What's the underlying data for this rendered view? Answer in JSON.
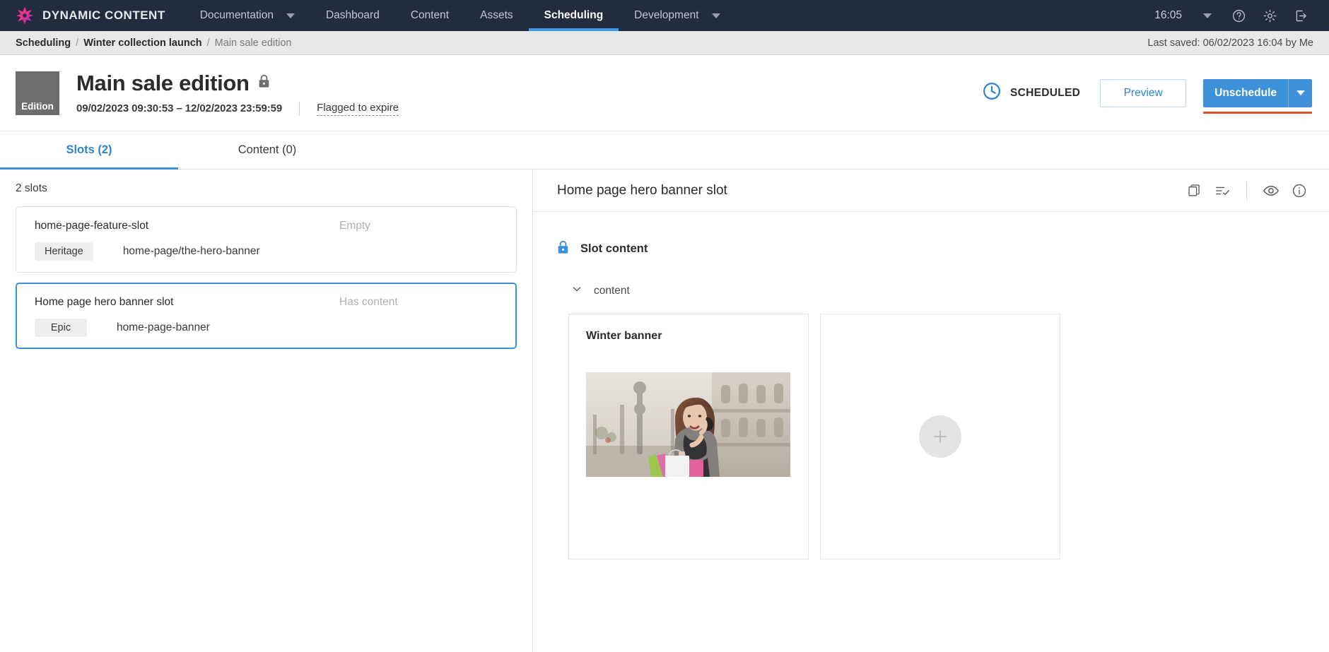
{
  "topnav": {
    "brand": "DYNAMIC CONTENT",
    "items": [
      {
        "label": "Documentation",
        "has_caret": true,
        "active": false
      },
      {
        "label": "Dashboard",
        "has_caret": false,
        "active": false
      },
      {
        "label": "Content",
        "has_caret": false,
        "active": false
      },
      {
        "label": "Assets",
        "has_caret": false,
        "active": false
      },
      {
        "label": "Scheduling",
        "has_caret": false,
        "active": true
      },
      {
        "label": "Development",
        "has_caret": true,
        "active": false
      }
    ],
    "time": "16:05",
    "icons": [
      "help-icon",
      "gear-icon",
      "logout-icon"
    ],
    "background": "#232c3d",
    "active_underline": "#3d9ae2"
  },
  "breadcrumb": {
    "items": [
      "Scheduling",
      "Winter collection launch",
      "Main sale edition"
    ],
    "separator": "/",
    "last_saved": "Last saved: 06/02/2023 16:04 by Me"
  },
  "header": {
    "badge": "Edition",
    "title": "Main sale edition",
    "locked": true,
    "date_range": "09/02/2023 09:30:53  –  12/02/2023 23:59:59",
    "flagged": "Flagged to expire",
    "status": "SCHEDULED",
    "status_icon": "clock-icon",
    "preview_label": "Preview",
    "unschedule_label": "Unschedule",
    "accent_blue": "#3d91d6",
    "underline_red": "#d9542b"
  },
  "tabs": [
    {
      "label": "Slots (2)",
      "active": true
    },
    {
      "label": "Content (0)",
      "active": false
    }
  ],
  "left_pane": {
    "count_label": "2 slots",
    "slots": [
      {
        "name": "home-page-feature-slot",
        "state": "Empty",
        "tag": "Heritage",
        "path": "home-page/the-hero-banner",
        "selected": false
      },
      {
        "name": "Home page hero banner slot",
        "state": "Has content",
        "tag": "Epic",
        "path": "home-page-banner",
        "selected": true
      }
    ]
  },
  "right_pane": {
    "title": "Home page hero banner slot",
    "icons": [
      "copy-icon",
      "list-check-icon",
      "eye-icon",
      "info-icon"
    ],
    "slot_content_label": "Slot content",
    "slot_content_locked": true,
    "group_label": "content",
    "group_expanded": true,
    "cards": [
      {
        "title": "Winter banner",
        "has_image": true
      },
      {
        "title": "",
        "has_image": false,
        "add_placeholder": true
      }
    ]
  }
}
